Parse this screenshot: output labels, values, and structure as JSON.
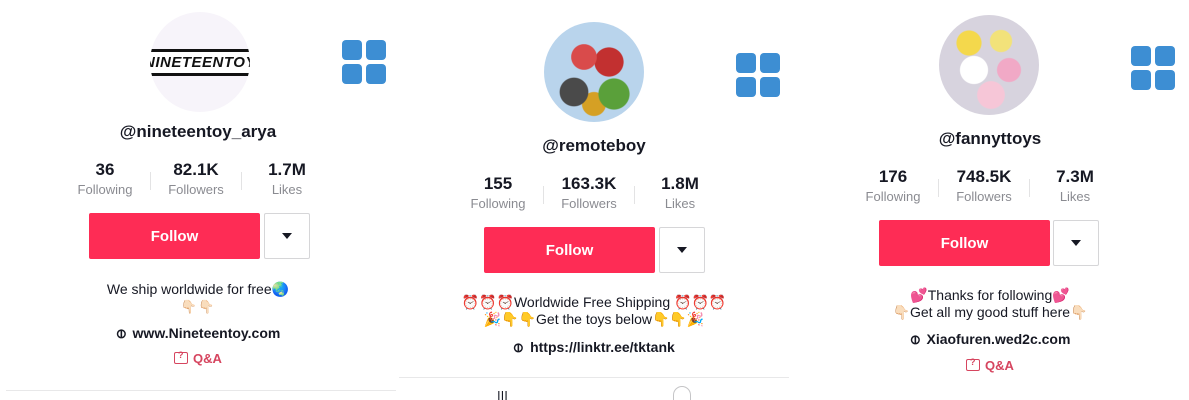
{
  "profiles": [
    {
      "avatar_text": "NINETEENTOY",
      "username": "@nineteentoy_arya",
      "stats": [
        {
          "value": "36",
          "label": "Following"
        },
        {
          "value": "82.1K",
          "label": "Followers"
        },
        {
          "value": "1.7M",
          "label": "Likes"
        }
      ],
      "follow_label": "Follow",
      "bio_line1": "We ship worldwide for free🌏",
      "bio_line2": "👇🏻👇🏻",
      "link": "www.Nineteentoy.com",
      "qa_label": "Q&A"
    },
    {
      "username": "@remoteboy",
      "stats": [
        {
          "value": "155",
          "label": "Following"
        },
        {
          "value": "163.3K",
          "label": "Followers"
        },
        {
          "value": "1.8M",
          "label": "Likes"
        }
      ],
      "follow_label": "Follow",
      "bio_line1": "⏰⏰⏰Worldwide Free Shipping ⏰⏰⏰",
      "bio_line2": "🎉👇👇Get the toys below👇👇🎉",
      "link": "https://linktr.ee/tktank"
    },
    {
      "username": "@fannyttoys",
      "stats": [
        {
          "value": "176",
          "label": "Following"
        },
        {
          "value": "748.5K",
          "label": "Followers"
        },
        {
          "value": "7.3M",
          "label": "Likes"
        }
      ],
      "follow_label": "Follow",
      "bio_line1": "💕Thanks for following💕",
      "bio_line2": "👇🏻Get all my good stuff here👇🏻",
      "link": "Xiaofuren.wed2c.com",
      "qa_label": "Q&A"
    }
  ],
  "colors": {
    "follow": "#fe2c55",
    "grid_icon": "#3d8ed3",
    "qa": "#d6455f"
  },
  "icons": [
    "grid-icon",
    "caret-down-icon",
    "link-icon",
    "qa-icon"
  ]
}
